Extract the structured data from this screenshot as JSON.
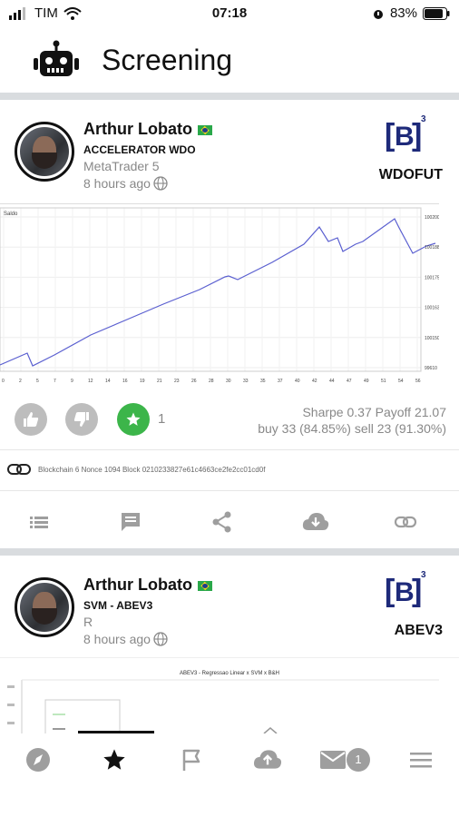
{
  "status_bar": {
    "carrier": "TIM",
    "time": "07:18",
    "battery": "83%"
  },
  "header": {
    "title": "Screening"
  },
  "cards": [
    {
      "author": "Arthur Lobato",
      "strategy": "ACCELERATOR WDO",
      "platform": "MetaTrader 5",
      "time_ago": "8 hours ago",
      "ticker": "WDOFUT",
      "chart": {
        "label": "Saldo",
        "y_ticks": [
          "100200",
          "100188",
          "100175",
          "100163",
          "100150",
          "99610"
        ],
        "x_ticks": [
          "0",
          "2",
          "5",
          "7",
          "9",
          "12",
          "14",
          "16",
          "19",
          "21",
          "23",
          "26",
          "28",
          "30",
          "33",
          "35",
          "37",
          "40",
          "42",
          "44",
          "47",
          "49",
          "51",
          "54",
          "56"
        ]
      },
      "like_count": "1",
      "stats_line1": "Sharpe 0.37 Payoff 21.07",
      "stats_line2": "buy 33 (84.85%) sell 23 (91.30%)",
      "blockchain": "Blockchain 6 Nonce 1094 Block 0210233827e61c4663ce2fe2cc01cd0f"
    },
    {
      "author": "Arthur Lobato",
      "strategy": "SVM - ABEV3",
      "platform": "R",
      "time_ago": "8 hours ago",
      "ticker": "ABEV3",
      "preview_title": "ABEV3 - Regressao Linear x SVM x B&H"
    }
  ],
  "b3_logo": {
    "text": "B",
    "sup": "3"
  },
  "icons": {
    "list": "list-icon",
    "comment": "comment-icon",
    "share": "share-icon",
    "download": "cloud-download-icon",
    "link": "link-icon",
    "nav": [
      "compass-icon",
      "star-icon",
      "flag-icon",
      "cloud-upload-icon",
      "mail-icon",
      "menu-icon"
    ]
  },
  "nav_badge": "1",
  "colors": {
    "accent_green": "#3cb54a",
    "b3_blue": "#1e2a7a",
    "chart_line": "#5a5fd0",
    "divider": "#d9dcdf"
  }
}
